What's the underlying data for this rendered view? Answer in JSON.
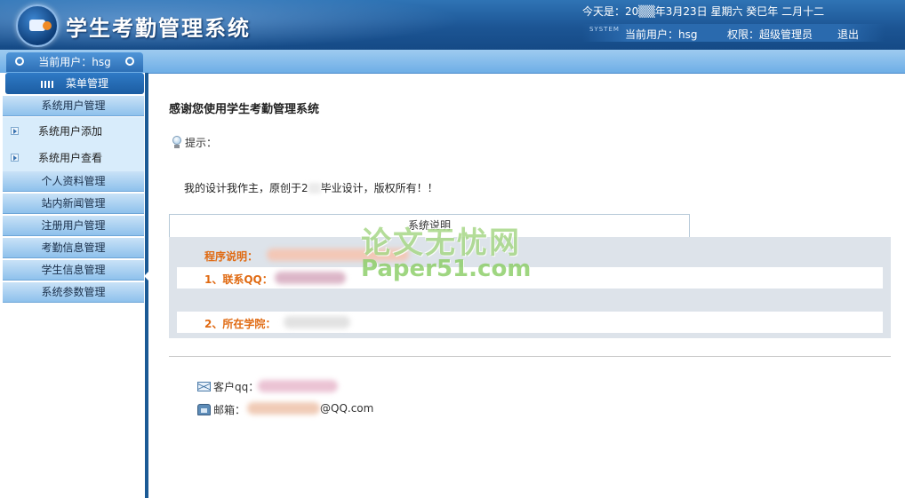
{
  "header": {
    "app_title": "学生考勤管理系统",
    "date_text": "今天是：20▒▒年3月23日  星期六  癸巳年  二月十二",
    "system_tag": "SYSTEM",
    "current_user": "当前用户：hsg",
    "permission": "权限：超级管理员",
    "logout": "退出"
  },
  "sidebar": {
    "current_user_tab": "当前用户：hsg",
    "menu_header": "菜单管理",
    "groups": [
      {
        "label": "系统用户管理"
      },
      {
        "label": "个人资料管理"
      },
      {
        "label": "站内新闻管理"
      },
      {
        "label": "注册用户管理"
      },
      {
        "label": "考勤信息管理"
      },
      {
        "label": "学生信息管理"
      },
      {
        "label": "系统参数管理"
      }
    ],
    "sub_items": [
      {
        "label": "系统用户添加"
      },
      {
        "label": "系统用户查看"
      }
    ]
  },
  "main": {
    "title": "感谢您使用学生考勤管理系统",
    "tip_label": "提示：",
    "notice_pre": "我的设计我作主，原创于2",
    "notice_post": "毕业设计，版权所有！！",
    "system_box": "系统说明",
    "program_label": "程序说明：",
    "qq_label": "1、联系QQ：",
    "college_label": "2、所在学院：",
    "client_qq": "客户qq：",
    "email_label": "邮箱：",
    "email_suffix": "@QQ.com"
  },
  "watermark": {
    "cn": "论文无忧网",
    "en": "Paper51.com"
  },
  "colors": {
    "header_blue": "#1c5594",
    "label_orange": "#e06a12",
    "panel_grey": "#dde3ea"
  }
}
